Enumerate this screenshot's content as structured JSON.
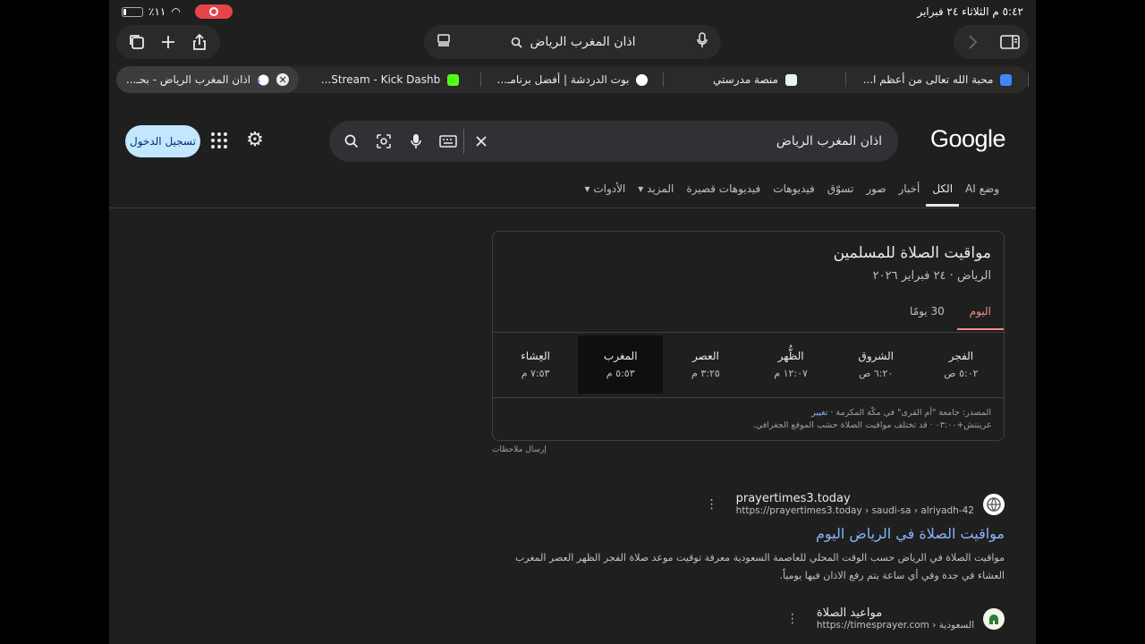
{
  "status": {
    "datetime": "٥:٤٢ م   الثلاثاء ٢٤ فبراير",
    "battery": "٪١١"
  },
  "toolbar": {
    "url_text": "اذان المغرب الرياض"
  },
  "tabs": [
    {
      "label": "اذان المغرب الرياض - بحـ...",
      "active": true,
      "favicon_color": "#ffffff"
    },
    {
      "label": "Stream - Kick Dashb...",
      "active": false,
      "favicon_color": "#53fc18"
    },
    {
      "label": "بوت الدردشة | أفضل برنامـ...",
      "active": false,
      "favicon_color": "#ffffff"
    },
    {
      "label": "منصة مدرستي",
      "active": false,
      "favicon_color": "#e8f5e9"
    },
    {
      "label": "محبة الله تعالى من أعظم ا...",
      "active": false,
      "favicon_color": "#4285f4"
    }
  ],
  "google": {
    "signin_label": "تسجيل الدخول",
    "query": "اذان المغرب الرياض",
    "logo": "Google",
    "nav": [
      "وضع AI",
      "الكل",
      "أخبار",
      "صور",
      "تسوّق",
      "فيديوهات",
      "فيديوهات قصيرة",
      "المزيد ▾",
      "الأدوات ▾"
    ]
  },
  "prayer_card": {
    "title": "مواقيت الصلاة للمسلمين",
    "subtitle": "الرياض · ٢٤ فبراير ٢٠٢٦",
    "tab_today": "اليوم",
    "tab_30": "30 يومًا",
    "times": [
      {
        "name": "الفجر",
        "time": "٥:٠٢ ص"
      },
      {
        "name": "الشروق",
        "time": "٦:٢٠ ص"
      },
      {
        "name": "الظُّهر",
        "time": "١٢:٠٧ م"
      },
      {
        "name": "العصر",
        "time": "٣:٢٥ م"
      },
      {
        "name": "المغرب",
        "time": "٥:٥٣ م"
      },
      {
        "name": "العِشاء",
        "time": "٧:٥٣ م"
      }
    ],
    "source_line": "المصدر: جامعة \"أم القرى\" في مكّة المكرمة · ",
    "source_link": "تغيير",
    "note_line": "غرينتش+٠٣:٠٠ · قد تختلف مواقيت الصلاة حسَب الموقع الجغرافي.",
    "feedback": "إرسال ملاحظات"
  },
  "results": [
    {
      "site": "prayertimes3.today",
      "url": "https://prayertimes3.today › saudi-sa › alriyadh-42",
      "title": "مواقيت الصلاة في الرياض اليوم",
      "snippet": "مواقيت الصلاة في الرياض حسب الوقت المحلي للعاصمة السعودية معرفة توقيت موعد صلاة الفجر الظهر العصر المغرب العشاء في جدة وفي أي ساعة يتم رفع الاذان فيها يومياً."
    },
    {
      "site": "مواعيد الصلاة",
      "url": "https://timesprayer.com › السعودية"
    }
  ]
}
